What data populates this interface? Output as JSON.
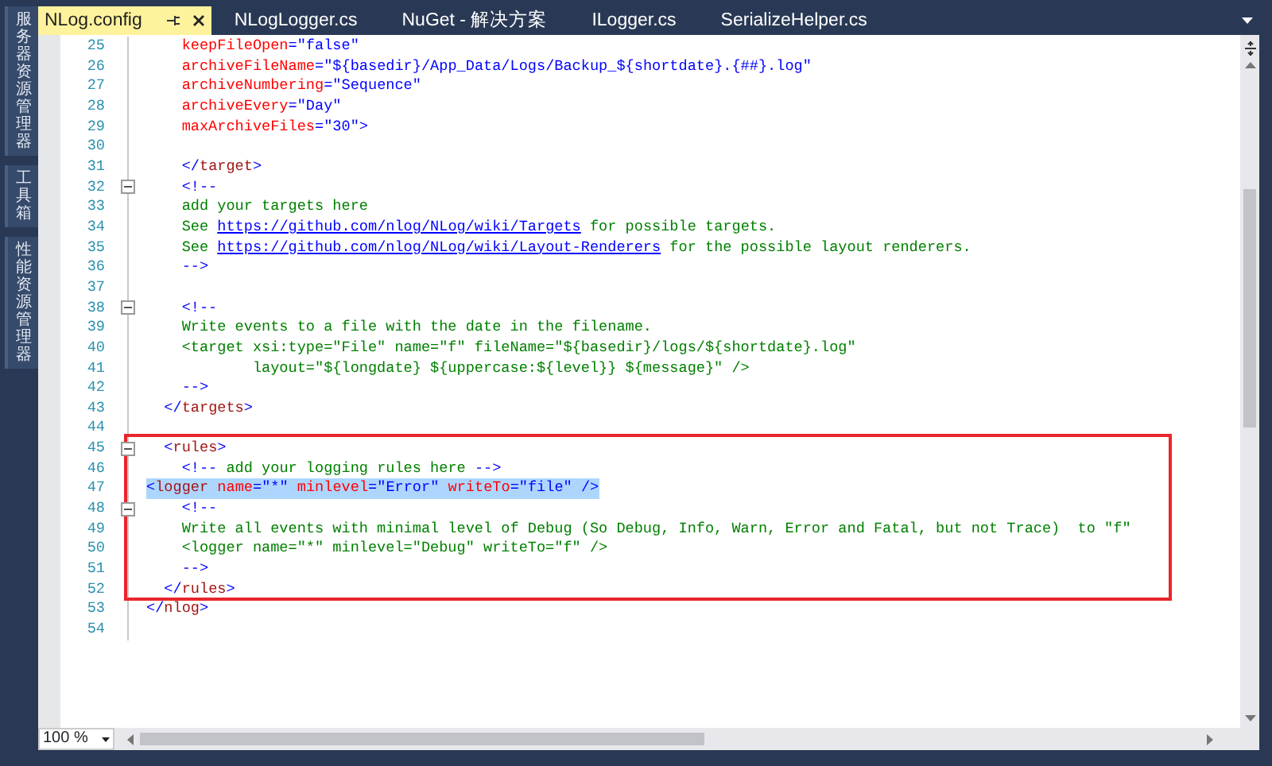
{
  "side_panels": [
    {
      "label": "服务器资源管理器"
    },
    {
      "label": "工具箱"
    },
    {
      "label": "性能资源管理器"
    }
  ],
  "tabs": [
    {
      "label": "NLog.config",
      "selected": true
    },
    {
      "label": "NLogLogger.cs",
      "selected": false
    },
    {
      "label": "NuGet - 解决方案",
      "selected": false
    },
    {
      "label": "ILogger.cs",
      "selected": false
    },
    {
      "label": "SerializeHelper.cs",
      "selected": false
    }
  ],
  "editor": {
    "sections": [
      {
        "boxed": false,
        "lines": [
          {
            "number": "25",
            "fold": false,
            "selected": false,
            "tokens": [
              {
                "kind": "attr",
                "text": "    keepFileOpen"
              },
              {
                "kind": "value",
                "text": "=\"false\""
              }
            ]
          },
          {
            "number": "26",
            "fold": false,
            "selected": false,
            "tokens": [
              {
                "kind": "attr",
                "text": "    archiveFileName"
              },
              {
                "kind": "value",
                "text": "=\"${basedir}/App_Data/Logs/Backup_${shortdate}.{##}.log\""
              }
            ]
          },
          {
            "number": "27",
            "fold": false,
            "selected": false,
            "tokens": [
              {
                "kind": "attr",
                "text": "    archiveNumbering"
              },
              {
                "kind": "value",
                "text": "=\"Sequence\""
              }
            ]
          },
          {
            "number": "28",
            "fold": false,
            "selected": false,
            "tokens": [
              {
                "kind": "attr",
                "text": "    archiveEvery"
              },
              {
                "kind": "value",
                "text": "=\"Day\""
              }
            ]
          },
          {
            "number": "29",
            "fold": false,
            "selected": false,
            "tokens": [
              {
                "kind": "attr",
                "text": "    maxArchiveFiles"
              },
              {
                "kind": "value",
                "text": "=\"30\""
              },
              {
                "kind": "delim",
                "text": ">"
              }
            ]
          },
          {
            "number": "30",
            "fold": false,
            "selected": false
          },
          {
            "number": "31",
            "fold": false,
            "selected": false,
            "tokens": [
              {
                "kind": "delim",
                "text": "    </"
              },
              {
                "kind": "element",
                "text": "target"
              },
              {
                "kind": "delim",
                "text": ">"
              }
            ]
          },
          {
            "number": "32",
            "fold": true,
            "selected": false,
            "tokens": [
              {
                "kind": "delim",
                "text": "    <!--"
              }
            ]
          },
          {
            "number": "33",
            "fold": false,
            "selected": false,
            "tokens": [
              {
                "kind": "comment",
                "text": "    add your targets here"
              }
            ]
          },
          {
            "number": "34",
            "fold": false,
            "selected": false,
            "tokens": [
              {
                "kind": "comment",
                "text": "    See "
              },
              {
                "kind": "link",
                "text": "https://github.com/nlog/NLog/wiki/Targets"
              },
              {
                "kind": "comment",
                "text": " for possible targets."
              }
            ]
          },
          {
            "number": "35",
            "fold": false,
            "selected": false,
            "tokens": [
              {
                "kind": "comment",
                "text": "    See "
              },
              {
                "kind": "link",
                "text": "https://github.com/nlog/NLog/wiki/Layout-Renderers"
              },
              {
                "kind": "comment",
                "text": " for the possible layout renderers."
              }
            ]
          },
          {
            "number": "36",
            "fold": false,
            "selected": false,
            "tokens": [
              {
                "kind": "delim",
                "text": "    -->"
              }
            ]
          },
          {
            "number": "37",
            "fold": false,
            "selected": false
          },
          {
            "number": "38",
            "fold": true,
            "selected": false,
            "tokens": [
              {
                "kind": "delim",
                "text": "    <!--"
              }
            ]
          },
          {
            "number": "39",
            "fold": false,
            "selected": false,
            "tokens": [
              {
                "kind": "comment",
                "text": "    Write events to a file with the date in the filename."
              }
            ]
          },
          {
            "number": "40",
            "fold": false,
            "selected": false,
            "tokens": [
              {
                "kind": "comment",
                "text": "    <target xsi:type=\"File\" name=\"f\" fileName=\"${basedir}/logs/${shortdate}.log\""
              }
            ]
          },
          {
            "number": "41",
            "fold": false,
            "selected": false,
            "tokens": [
              {
                "kind": "comment",
                "text": "            layout=\"${longdate} ${uppercase:${level}} ${message}\" />"
              }
            ]
          },
          {
            "number": "42",
            "fold": false,
            "selected": false,
            "tokens": [
              {
                "kind": "delim",
                "text": "    -->"
              }
            ]
          },
          {
            "number": "43",
            "fold": false,
            "selected": false,
            "tokens": [
              {
                "kind": "delim",
                "text": "  </"
              },
              {
                "kind": "element",
                "text": "targets"
              },
              {
                "kind": "delim",
                "text": ">"
              }
            ]
          },
          {
            "number": "44",
            "fold": false,
            "selected": false
          }
        ]
      },
      {
        "boxed": true,
        "lines": [
          {
            "number": "45",
            "fold": true,
            "selected": false,
            "tokens": [
              {
                "kind": "delim",
                "text": "  <"
              },
              {
                "kind": "element",
                "text": "rules"
              },
              {
                "kind": "delim",
                "text": ">"
              }
            ]
          },
          {
            "number": "46",
            "fold": false,
            "selected": false,
            "tokens": [
              {
                "kind": "delim",
                "text": "    <!--"
              },
              {
                "kind": "comment",
                "text": " add your logging rules here "
              },
              {
                "kind": "delim",
                "text": "-->"
              }
            ]
          },
          {
            "number": "47",
            "fold": false,
            "selected": true,
            "tokens": [
              {
                "kind": "delim",
                "text": "<"
              },
              {
                "kind": "element",
                "text": "logger"
              },
              {
                "kind": "attr",
                "text": " name"
              },
              {
                "kind": "value",
                "text": "=\"*\""
              },
              {
                "kind": "attr",
                "text": " minlevel"
              },
              {
                "kind": "value",
                "text": "=\"Error\""
              },
              {
                "kind": "attr",
                "text": " writeTo"
              },
              {
                "kind": "value",
                "text": "=\"file\""
              },
              {
                "kind": "delim",
                "text": " />"
              }
            ]
          },
          {
            "number": "48",
            "fold": true,
            "selected": false,
            "tokens": [
              {
                "kind": "delim",
                "text": "    <!--"
              }
            ]
          },
          {
            "number": "49",
            "fold": false,
            "selected": false,
            "tokens": [
              {
                "kind": "comment",
                "text": "    Write all events with minimal level of Debug (So Debug, Info, Warn, Error and Fatal, but not Trace)  to \"f\""
              }
            ]
          },
          {
            "number": "50",
            "fold": false,
            "selected": false,
            "tokens": [
              {
                "kind": "comment",
                "text": "    <logger name=\"*\" minlevel=\"Debug\" writeTo=\"f\" />"
              }
            ]
          },
          {
            "number": "51",
            "fold": false,
            "selected": false,
            "tokens": [
              {
                "kind": "delim",
                "text": "    -->"
              }
            ]
          },
          {
            "number": "52",
            "fold": false,
            "selected": false,
            "tokens": [
              {
                "kind": "delim",
                "text": "  </"
              },
              {
                "kind": "element",
                "text": "rules"
              },
              {
                "kind": "delim",
                "text": ">"
              }
            ]
          }
        ]
      },
      {
        "boxed": false,
        "lines": [
          {
            "number": "53",
            "fold": false,
            "selected": false,
            "tokens": [
              {
                "kind": "delim",
                "text": "</"
              },
              {
                "kind": "element",
                "text": "nlog"
              },
              {
                "kind": "delim",
                "text": ">"
              }
            ]
          },
          {
            "number": "54",
            "fold": false,
            "selected": false
          }
        ]
      }
    ]
  },
  "zoom": {
    "value": "100 %"
  }
}
